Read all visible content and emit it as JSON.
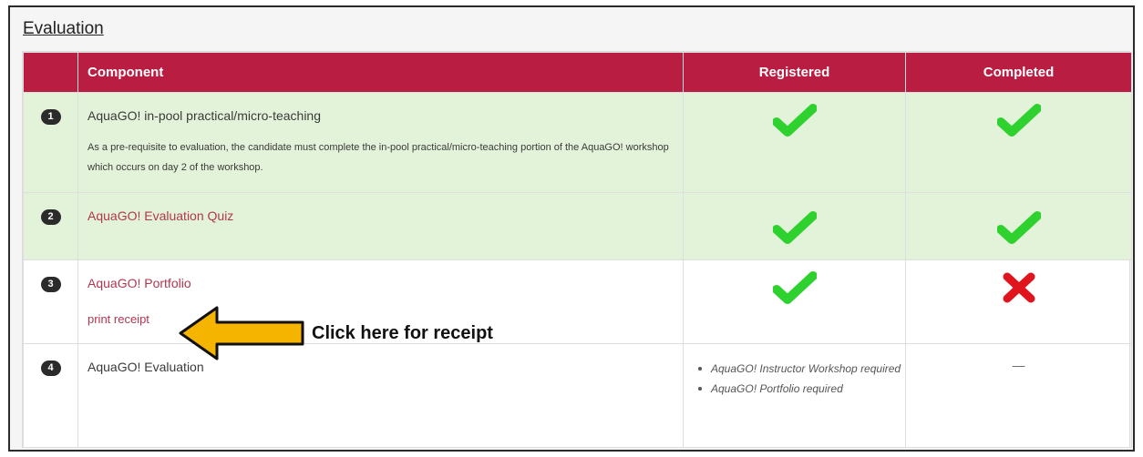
{
  "section_title": "Evaluation",
  "headers": {
    "component": "Component",
    "registered": "Registered",
    "completed": "Completed"
  },
  "rows": [
    {
      "num": "1",
      "title": "AquaGO! in-pool practical/micro-teaching",
      "description": "As a pre-requisite to evaluation, the candidate must complete the in-pool practical/micro-teaching portion of the AquaGO! workshop which occurs on day 2 of the workshop.",
      "registered": "check-icon",
      "completed": "check-icon"
    },
    {
      "num": "2",
      "title": "AquaGO! Evaluation Quiz",
      "registered": "check-icon",
      "completed": "check-icon"
    },
    {
      "num": "3",
      "title": "AquaGO! Portfolio",
      "link": "print receipt",
      "registered": "check-icon",
      "completed": "cross-icon"
    },
    {
      "num": "4",
      "title": "AquaGO! Evaluation",
      "requirements": [
        "AquaGO! Instructor Workshop required",
        "AquaGO! Portfolio required"
      ],
      "completed": "—"
    }
  ],
  "annotation": {
    "callout": "Click here for receipt",
    "icon": "arrow-left-icon"
  },
  "colors": {
    "header": "#b91d42",
    "row_completed": "#e3f3d9",
    "check": "#2fd12f",
    "cross": "#e0141c",
    "link": "#b0374f",
    "arrow": "#f5b400"
  }
}
